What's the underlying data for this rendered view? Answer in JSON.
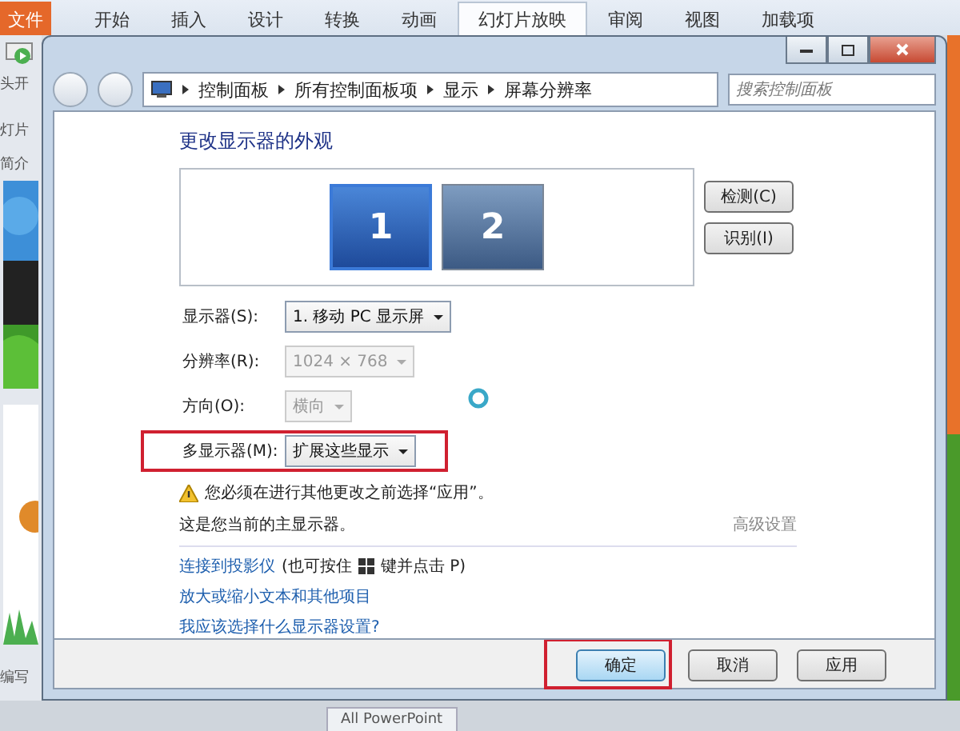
{
  "ribbon": {
    "tabs": [
      {
        "label": "文件",
        "kind": "file",
        "selected": false
      },
      {
        "label": "开始",
        "kind": "tab",
        "selected": false
      },
      {
        "label": "插入",
        "kind": "tab",
        "selected": false
      },
      {
        "label": "设计",
        "kind": "tab",
        "selected": false
      },
      {
        "label": "转换",
        "kind": "tab",
        "selected": false
      },
      {
        "label": "动画",
        "kind": "tab",
        "selected": false
      },
      {
        "label": "幻灯片放映",
        "kind": "tab",
        "selected": true
      },
      {
        "label": "审阅",
        "kind": "tab",
        "selected": false
      },
      {
        "label": "视图",
        "kind": "tab",
        "selected": false
      },
      {
        "label": "加载项",
        "kind": "tab",
        "selected": false
      }
    ]
  },
  "left_panel": {
    "button_label": "头开",
    "group_label": "灯片",
    "section_label": "简介",
    "footer_label": "编写"
  },
  "window": {
    "breadcrumb": [
      "控制面板",
      "所有控制面板项",
      "显示",
      "屏幕分辨率"
    ],
    "search": {
      "placeholder": "搜索控制面板"
    },
    "heading": "更改显示器的外观",
    "monitors": [
      {
        "label": "1",
        "selected": true
      },
      {
        "label": "2",
        "selected": false
      }
    ],
    "side_buttons": [
      "检测(C)",
      "识别(I)"
    ],
    "settings": [
      {
        "label": "显示器(S):",
        "value": "1. 移动 PC 显示屏",
        "disabled": false,
        "highlighted": false
      },
      {
        "label": "分辨率(R):",
        "value": "1024 × 768",
        "disabled": true,
        "highlighted": false
      },
      {
        "label": "方向(O):",
        "value": "横向",
        "disabled": true,
        "highlighted": false
      },
      {
        "label": "多显示器(M):",
        "value": "扩展这些显示",
        "disabled": false,
        "highlighted": true
      }
    ],
    "warning": "您必须在进行其他更改之前选择“应用”。",
    "primary_note": "这是您当前的主显示器。",
    "advanced_link": "高级设置",
    "projector_link": "连接到投影仪",
    "projector_hint_before": "(也可按住",
    "projector_hint_after": "键并点击 P)",
    "links": [
      "放大或缩小文本和其他项目",
      "我应该选择什么显示器设置?"
    ],
    "footer_buttons": [
      {
        "label": "确定",
        "highlighted": true
      },
      {
        "label": "取消",
        "highlighted": false
      },
      {
        "label": "应用",
        "highlighted": false
      }
    ]
  },
  "bottom_tab": "All PowerPoint"
}
